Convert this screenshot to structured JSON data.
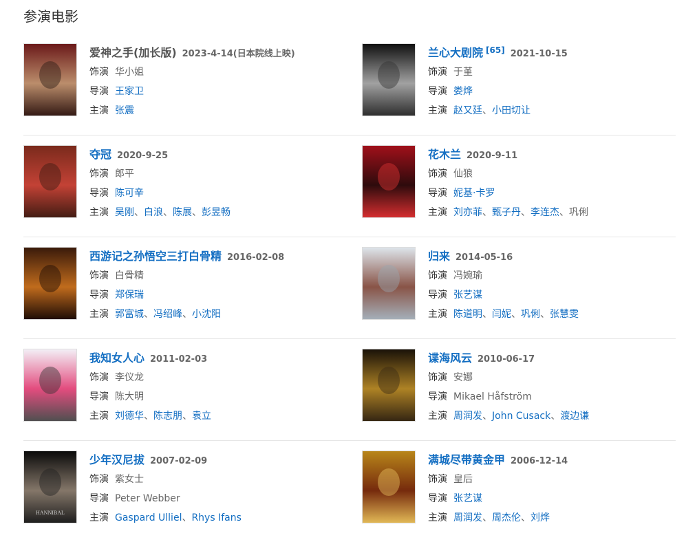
{
  "section_title": "参演电影",
  "labels": {
    "role": "饰演",
    "director": "导演",
    "starring": "主演"
  },
  "movies": [
    {
      "title": "爱神之手(加长版)",
      "title_linked": false,
      "sup": "",
      "date": "2023-4-14(日本院线上映)",
      "role": "华小姐",
      "director": [
        {
          "name": "王家卫",
          "link": true
        }
      ],
      "starring": [
        {
          "name": "张震",
          "link": true
        }
      ],
      "poster_colors": [
        "#6b1a1a",
        "#c9a27a",
        "#2b1a14"
      ]
    },
    {
      "title": "兰心大剧院",
      "title_linked": true,
      "sup": "[65]",
      "date": "2021-10-15",
      "role": "于堇",
      "director": [
        {
          "name": "娄烨",
          "link": true
        }
      ],
      "starring": [
        {
          "name": "赵又廷",
          "link": true
        },
        {
          "name": "小田切让",
          "link": true
        }
      ],
      "poster_colors": [
        "#111",
        "#bbb",
        "#333"
      ]
    },
    {
      "title": "夺冠",
      "title_linked": true,
      "sup": "",
      "date": "2020-9-25",
      "role": "郎平",
      "director": [
        {
          "name": "陈可辛",
          "link": true
        }
      ],
      "starring": [
        {
          "name": "吴刚",
          "link": true
        },
        {
          "name": "白浪",
          "link": true
        },
        {
          "name": "陈展",
          "link": true
        },
        {
          "name": "彭昱畅",
          "link": true
        }
      ],
      "poster_colors": [
        "#7a2a1c",
        "#d0463a",
        "#3a1a12"
      ]
    },
    {
      "title": "花木兰",
      "title_linked": true,
      "sup": "",
      "date": "2020-9-11",
      "role": "仙狼",
      "director": [
        {
          "name": "妮基·卡罗",
          "link": true
        }
      ],
      "starring": [
        {
          "name": "刘亦菲",
          "link": true
        },
        {
          "name": "甄子丹",
          "link": true
        },
        {
          "name": "李连杰",
          "link": true
        },
        {
          "name": "巩俐",
          "link": false
        }
      ],
      "poster_colors": [
        "#a0101a",
        "#1a0a0a",
        "#d33"
      ]
    },
    {
      "title": "西游记之孙悟空三打白骨精",
      "title_linked": true,
      "sup": "",
      "date": "2016-02-08",
      "role": "白骨精",
      "director": [
        {
          "name": "郑保瑞",
          "link": true
        }
      ],
      "starring": [
        {
          "name": "郭富城",
          "link": true
        },
        {
          "name": "冯绍峰",
          "link": true
        },
        {
          "name": "小沈阳",
          "link": true
        }
      ],
      "poster_colors": [
        "#3a1a0a",
        "#d87a20",
        "#1a0a05"
      ]
    },
    {
      "title": "归来",
      "title_linked": true,
      "sup": "",
      "date": "2014-05-16",
      "role": "冯婉瑜",
      "director": [
        {
          "name": "张艺谋",
          "link": true
        }
      ],
      "starring": [
        {
          "name": "陈道明",
          "link": true
        },
        {
          "name": "闫妮",
          "link": true
        },
        {
          "name": "巩俐",
          "link": true
        },
        {
          "name": "张慧雯",
          "link": true
        }
      ],
      "poster_colors": [
        "#dde4ea",
        "#7a3a2a",
        "#9aa6b0"
      ]
    },
    {
      "title": "我知女人心",
      "title_linked": true,
      "sup": "",
      "date": "2011-02-03",
      "role": "李仪龙",
      "director": [
        {
          "name": "陈大明",
          "link": false
        }
      ],
      "starring": [
        {
          "name": "刘德华",
          "link": true
        },
        {
          "name": "陈志朋",
          "link": true
        },
        {
          "name": "袁立",
          "link": true
        }
      ],
      "poster_colors": [
        "#f3eef5",
        "#e0306a",
        "#333"
      ]
    },
    {
      "title": "谍海风云",
      "title_linked": true,
      "sup": "",
      "date": "2010-06-17",
      "role": "安娜",
      "director": [
        {
          "name": "Mikael Håfström",
          "link": false
        }
      ],
      "starring": [
        {
          "name": "周润发",
          "link": true
        },
        {
          "name": "John Cusack",
          "link": true
        },
        {
          "name": "渡边谦",
          "link": true
        }
      ],
      "poster_colors": [
        "#1a1208",
        "#c8962a",
        "#3a2a14"
      ]
    },
    {
      "title": "少年汉尼拔",
      "title_linked": true,
      "sup": "",
      "date": "2007-02-09",
      "role": "紫女士",
      "director": [
        {
          "name": "Peter Webber",
          "link": false
        }
      ],
      "starring": [
        {
          "name": "Gaspard Ulliel",
          "link": true
        },
        {
          "name": "Rhys Ifans",
          "link": true
        }
      ],
      "poster_colors": [
        "#0a0a0a",
        "#9a8a7a",
        "#222"
      ]
    },
    {
      "title": "满城尽带黄金甲",
      "title_linked": true,
      "sup": "",
      "date": "2006-12-14",
      "role": "皇后",
      "director": [
        {
          "name": "张艺谋",
          "link": true
        }
      ],
      "starring": [
        {
          "name": "周润发",
          "link": true
        },
        {
          "name": "周杰伦",
          "link": true
        },
        {
          "name": "刘烨",
          "link": true
        }
      ],
      "poster_colors": [
        "#b8861a",
        "#6a1a0a",
        "#e8c060"
      ]
    }
  ],
  "poster_texts": {
    "hannibal": "HANNIBAL"
  }
}
